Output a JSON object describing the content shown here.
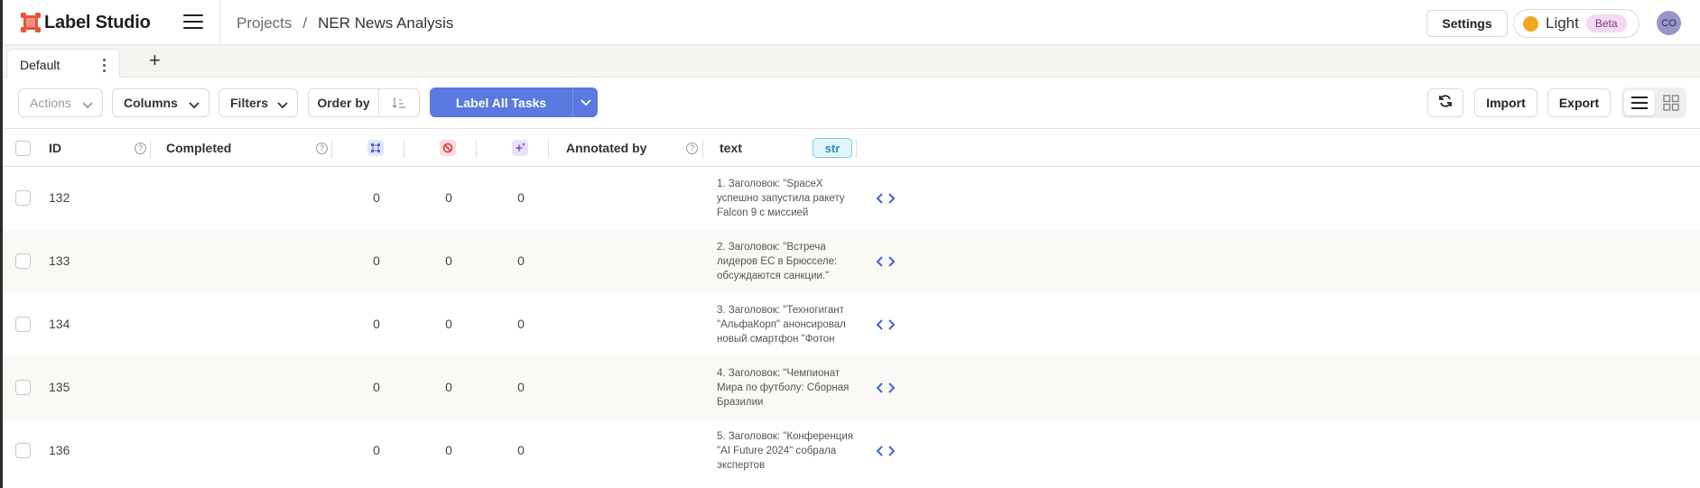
{
  "header": {
    "app_name": "Label Studio",
    "breadcrumbs": [
      "Projects",
      "/",
      "NER News Analysis"
    ],
    "settings_label": "Settings",
    "theme_label": "Light",
    "theme_badge": "Beta",
    "avatar_initials": "CO"
  },
  "tabs": [
    {
      "label": "Default"
    }
  ],
  "toolbar": {
    "actions_label": "Actions",
    "columns_label": "Columns",
    "filters_label": "Filters",
    "order_by_label": "Order by",
    "label_all_label": "Label All Tasks",
    "import_label": "Import",
    "export_label": "Export"
  },
  "table": {
    "columns": {
      "id": "ID",
      "completed": "Completed",
      "annotated_by": "Annotated by",
      "text": "text",
      "text_type": "str"
    },
    "rows": [
      {
        "id": "132",
        "c1": "0",
        "c2": "0",
        "c3": "0",
        "text": "1. Заголовок: \"SpaceX успешно запустила ракету Falcon 9 с миссией"
      },
      {
        "id": "133",
        "c1": "0",
        "c2": "0",
        "c3": "0",
        "text": "2. Заголовок: \"Встреча лидеров ЕС в Брюсселе: обсуждаются санкции.\""
      },
      {
        "id": "134",
        "c1": "0",
        "c2": "0",
        "c3": "0",
        "text": "3. Заголовок: \"Техногигант \"АльфаКорп\" анонсировал новый смартфон \"Фотон"
      },
      {
        "id": "135",
        "c1": "0",
        "c2": "0",
        "c3": "0",
        "text": "4. Заголовок: \"Чемпионат Мира по футболу: Сборная Бразилии"
      },
      {
        "id": "136",
        "c1": "0",
        "c2": "0",
        "c3": "0",
        "text": "5. Заголовок: \"Конференция \"AI Future 2024\" собрала экспертов"
      }
    ]
  },
  "colors": {
    "brand": "#e8543a",
    "primary_button": "#5b79e0",
    "beta_badge": "#f3d9f1",
    "theme_sun": "#f4a71d"
  }
}
